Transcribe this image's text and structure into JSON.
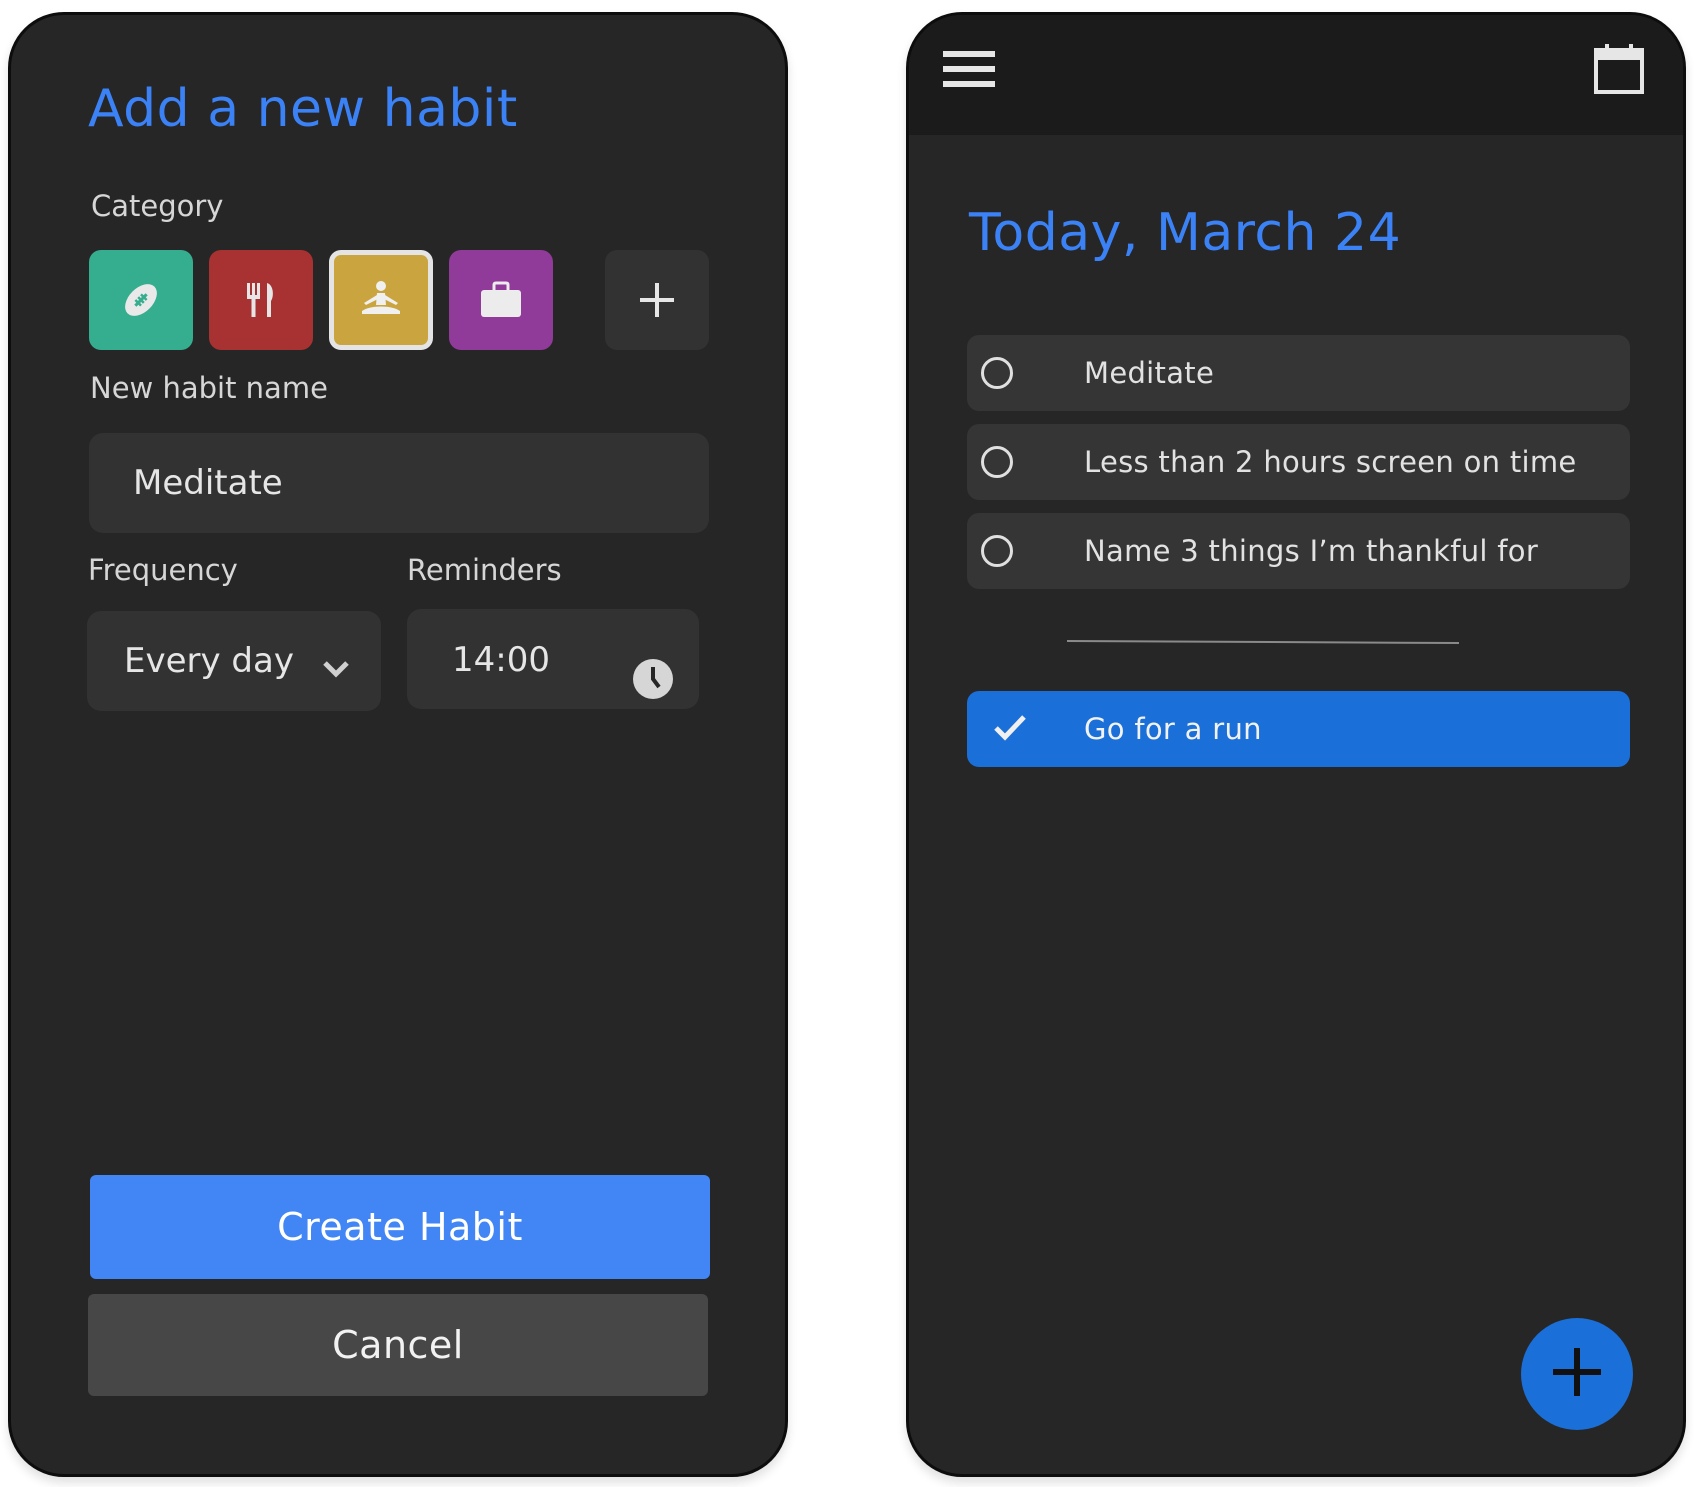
{
  "add_habit": {
    "title": "Add a new habit",
    "category_label": "Category",
    "categories": [
      {
        "icon": "football-icon",
        "color": "#35ad8f"
      },
      {
        "icon": "fork-knife-icon",
        "color": "#a83131"
      },
      {
        "icon": "meditation-icon",
        "color": "#caa43f",
        "selected": true
      },
      {
        "icon": "briefcase-icon",
        "color": "#903a9a"
      }
    ],
    "add_category_icon": "plus-icon",
    "name_label": "New habit name",
    "name_value": "Meditate",
    "frequency_label": "Frequency",
    "frequency_value": "Every day",
    "reminders_label": "Reminders",
    "reminder_value": "14:00",
    "create_button": "Create Habit",
    "cancel_button": "Cancel"
  },
  "today": {
    "title": "Today, March 24",
    "menu_icon": "hamburger-menu-icon",
    "calendar_icon": "calendar-icon",
    "habits": [
      {
        "name": "Meditate",
        "done": false
      },
      {
        "name": "Less than 2 hours screen on time",
        "done": false
      },
      {
        "name": "Name 3 things I’m thankful for",
        "done": false
      }
    ],
    "completed": [
      {
        "name": "Go for a run",
        "done": true
      }
    ],
    "fab_icon": "plus-icon"
  },
  "colors": {
    "accent": "#4285f4",
    "title_blue": "#3b82f6",
    "done_blue": "#1a6fd8",
    "background": "#262626"
  }
}
